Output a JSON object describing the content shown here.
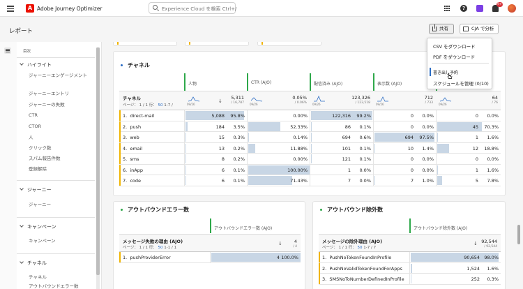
{
  "app": {
    "name": "Adobe Journey Optimizer",
    "logo_letter": "A",
    "search_placeholder": "Experience Cloud を検索 Ctrl+/",
    "help_symbol": "?",
    "notification_count": "9+"
  },
  "page": {
    "title": "レポート",
    "share_label": "共有",
    "cja_label": "CJA で分析"
  },
  "share_menu": {
    "items": [
      "CSV をダウンロード",
      "PDF をダウンロード",
      "書き出し予約",
      "スケジュールを管理 (0/10)"
    ]
  },
  "sidebar": {
    "toc_title": "目次",
    "sections": [
      {
        "title": "ハイライト",
        "items": [
          "ジャーニーエンゲージメント",
          "ジャーニーエントリ",
          "ジャーニーの失敗",
          "CTR",
          "CTOR",
          "人",
          "クリック数",
          "スパム報告件数",
          "登録解除"
        ]
      },
      {
        "title": "ジャーニー",
        "items": [
          "ジャーニー"
        ]
      },
      {
        "title": "キャンペーン",
        "items": [
          "キャンペーン"
        ]
      },
      {
        "title": "チャネル",
        "items": [
          "チャネル",
          "アウトバウンドエラー数"
        ]
      }
    ]
  },
  "channel_table": {
    "title": "チャネル",
    "dimension": "チャネル",
    "pagination": {
      "prefix": "ページ：",
      "page": "1",
      "of": "/ 1",
      "rows_label": "行：",
      "rows": "50",
      "range": "1-7 /"
    },
    "spark_label": "09/26",
    "columns": [
      {
        "name": "人物",
        "total": "5,311",
        "total_sub": "/ 16,787"
      },
      {
        "name": "CTR (AJO)",
        "total": "0.05%",
        "total_sub": "/ 0.06%"
      },
      {
        "name": "配信済み (AJO)",
        "total": "123,326",
        "total_sub": "/ 123,518"
      },
      {
        "name": "表示数 (AJO)",
        "total": "712",
        "total_sub": "/ 733"
      },
      {
        "name": "",
        "total": "64",
        "total_sub": "/ 76"
      }
    ],
    "rows": [
      {
        "n": "1.",
        "label": "direct-mail",
        "c": [
          [
            "5,088",
            "95.8%",
            0.958
          ],
          [
            "",
            "0.00%",
            0
          ],
          [
            "122,316",
            "99.2%",
            0.992
          ],
          [
            "0",
            "0.0%",
            0
          ],
          [
            "0",
            "0.0%",
            0
          ]
        ]
      },
      {
        "n": "2.",
        "label": "push",
        "c": [
          [
            "184",
            "3.5%",
            0.035
          ],
          [
            "",
            "52.33%",
            0.5233
          ],
          [
            "86",
            "0.1%",
            0.001
          ],
          [
            "0",
            "0.0%",
            0
          ],
          [
            "45",
            "70.3%",
            0.703
          ]
        ]
      },
      {
        "n": "3.",
        "label": "web",
        "c": [
          [
            "15",
            "0.3%",
            0.003
          ],
          [
            "",
            "0.14%",
            0.0014
          ],
          [
            "694",
            "0.6%",
            0.006
          ],
          [
            "694",
            "97.5%",
            0.975
          ],
          [
            "1",
            "1.6%",
            0.016
          ]
        ]
      },
      {
        "n": "4.",
        "label": "email",
        "c": [
          [
            "13",
            "0.2%",
            0.002
          ],
          [
            "",
            "11.88%",
            0.1188
          ],
          [
            "101",
            "0.1%",
            0.001
          ],
          [
            "10",
            "1.4%",
            0.014
          ],
          [
            "12",
            "18.8%",
            0.188
          ]
        ]
      },
      {
        "n": "5.",
        "label": "sms",
        "c": [
          [
            "8",
            "0.2%",
            0.002
          ],
          [
            "",
            "0.00%",
            0
          ],
          [
            "121",
            "0.1%",
            0.001
          ],
          [
            "0",
            "0.0%",
            0
          ],
          [
            "0",
            "0.0%",
            0
          ]
        ]
      },
      {
        "n": "6.",
        "label": "inApp",
        "c": [
          [
            "6",
            "0.1%",
            0.001
          ],
          [
            "",
            "100.00%",
            1.0
          ],
          [
            "1",
            "0.0%",
            0
          ],
          [
            "0",
            "0.0%",
            0
          ],
          [
            "1",
            "1.6%",
            0.016
          ]
        ]
      },
      {
        "n": "7.",
        "label": "code",
        "c": [
          [
            "6",
            "0.1%",
            0.001
          ],
          [
            "",
            "71.43%",
            0.7143
          ],
          [
            "7",
            "0.0%",
            0
          ],
          [
            "7",
            "1.0%",
            0.01
          ],
          [
            "5",
            "7.8%",
            0.078
          ]
        ]
      }
    ]
  },
  "error_table": {
    "title": "アウトバウンドエラー数",
    "column": "アウトバウンドエラー数 (AJO)",
    "dimension": "メッセージ失敗の理由 (AJO)",
    "pagination": {
      "prefix": "ページ：",
      "page": "1",
      "of": "/ 1",
      "rows_label": "行：",
      "rows": "50",
      "range": "1-1 / 1"
    },
    "total": "4",
    "total_sub": "/ 4",
    "rows": [
      {
        "n": "1.",
        "label": "pushProviderError",
        "v": "4",
        "p": "100.0%",
        "f": 1.0
      }
    ]
  },
  "exclusion_table": {
    "title": "アウトバウンド除外数",
    "column": "アウトバウンド除外数 (AJO)",
    "dimension": "メッセージの除外理由 (AJO)",
    "pagination": {
      "prefix": "ページ：",
      "page": "1",
      "of": "/ 1",
      "rows_label": "行：",
      "rows": "50",
      "range": "1-7 / 7"
    },
    "total": "92,544",
    "total_sub": "/ 92,544",
    "rows": [
      {
        "n": "1.",
        "label": "PushNoTokenFoundInProfile",
        "v": "90,654",
        "p": "98.0%",
        "f": 0.98
      },
      {
        "n": "2.",
        "label": "PushNoValidTokenFoundForApps",
        "v": "1,524",
        "p": "1.6%",
        "f": 0.016
      },
      {
        "n": "3.",
        "label": "SMSNoToNumberDefinedInProfile",
        "v": "252",
        "p": "0.3%",
        "f": 0.003
      }
    ]
  },
  "colors": {
    "accent": "#2ea84a",
    "bar_fill": "#c8d6e5",
    "row_marker": "#f0b400",
    "link": "#2a6cc4",
    "channel_dot": "#2a6cc4",
    "outbound_dot": "#2ea84a"
  }
}
